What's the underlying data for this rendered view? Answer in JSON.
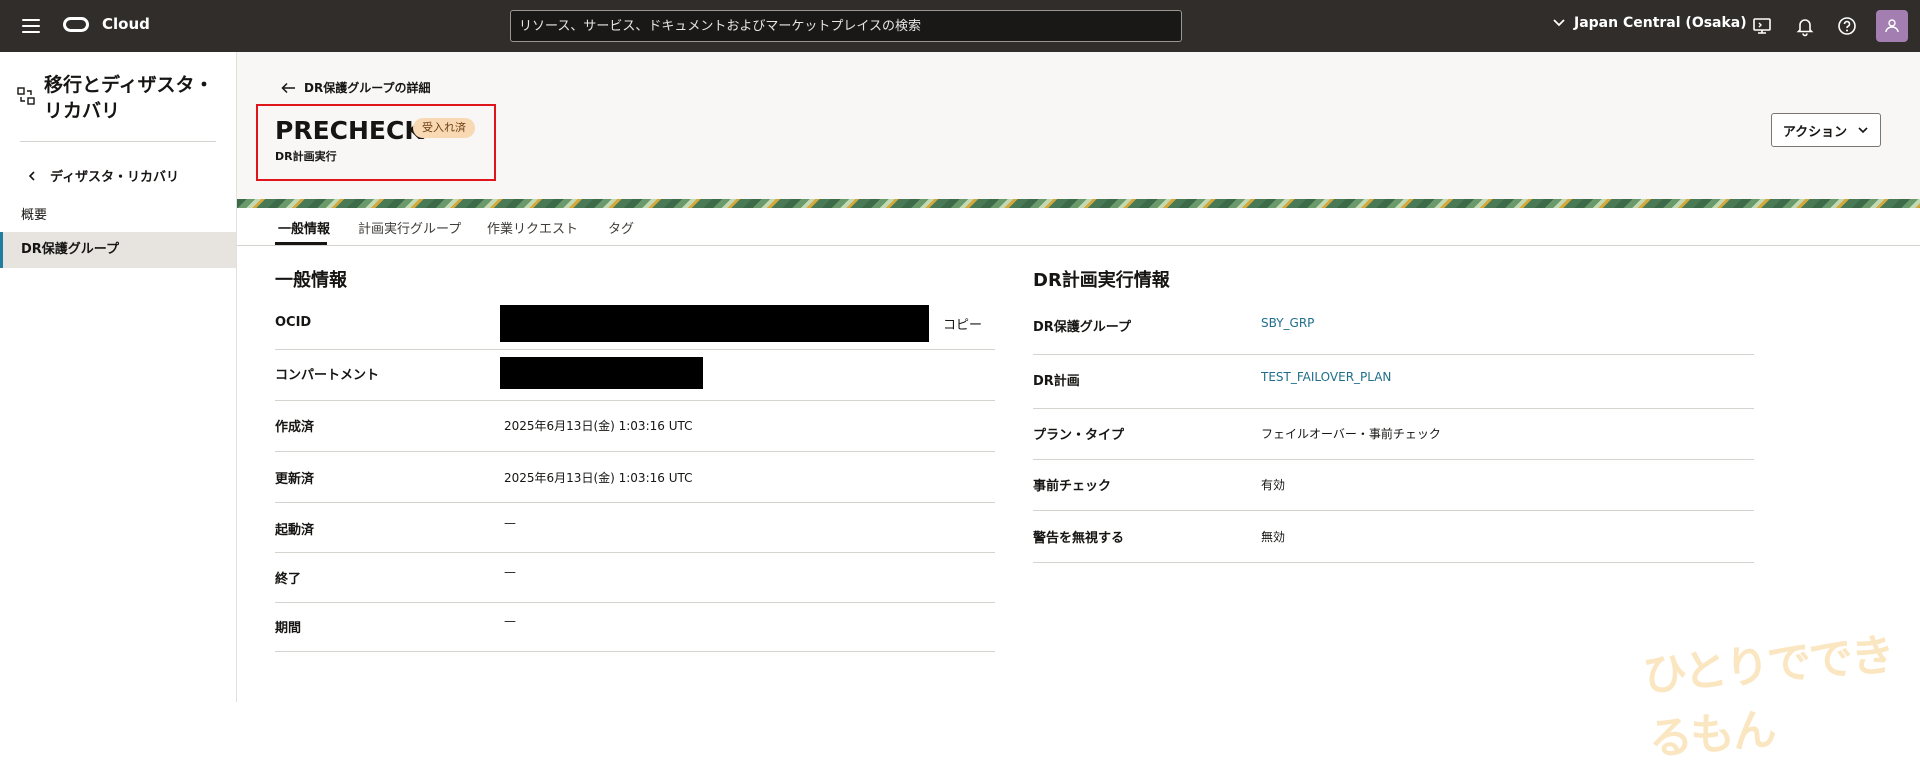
{
  "topbar": {
    "brand": "Cloud",
    "search_placeholder": "リソース、サービス、ドキュメントおよびマーケットプレイスの検索",
    "region": "Japan Central (Osaka)"
  },
  "sidebar": {
    "title": "移行とディザスタ・リカバリ",
    "back_label": "ディザスタ・リカバリ",
    "items": [
      {
        "label": "概要"
      },
      {
        "label": "DR保護グループ"
      }
    ]
  },
  "header": {
    "back_label": "DR保護グループの詳細",
    "title": "PRECHECK",
    "badge": "受入れ済",
    "subtitle": "DR計画実行",
    "action_label": "アクション"
  },
  "tabs": [
    {
      "label": "一般情報"
    },
    {
      "label": "計画実行グループ"
    },
    {
      "label": "作業リクエスト"
    },
    {
      "label": "タグ"
    }
  ],
  "general": {
    "heading": "一般情報",
    "copy_label": "コピー",
    "rows": [
      {
        "label": "OCID",
        "value": ""
      },
      {
        "label": "コンパートメント",
        "value": ""
      },
      {
        "label": "作成済",
        "value": "2025年6月13日(金) 1:03:16 UTC"
      },
      {
        "label": "更新済",
        "value": "2025年6月13日(金) 1:03:16 UTC"
      },
      {
        "label": "起動済",
        "value": "—"
      },
      {
        "label": "終了",
        "value": "—"
      },
      {
        "label": "期間",
        "value": "—"
      }
    ]
  },
  "dr_info": {
    "heading": "DR計画実行情報",
    "rows": [
      {
        "label": "DR保護グループ",
        "value": "SBY_GRP"
      },
      {
        "label": "DR計画",
        "value": "TEST_FAILOVER_PLAN"
      },
      {
        "label": "プラン・タイプ",
        "value": "フェイルオーバー・事前チェック"
      },
      {
        "label": "事前チェック",
        "value": "有効"
      },
      {
        "label": "警告を無視する",
        "value": "無効"
      }
    ]
  },
  "watermark": "ひとりでできるもん",
  "colors": {
    "topbar": "#312d2a",
    "link": "#1f6e8c",
    "badge_bg": "#f8d9b4",
    "highlight": "#e0151b"
  }
}
